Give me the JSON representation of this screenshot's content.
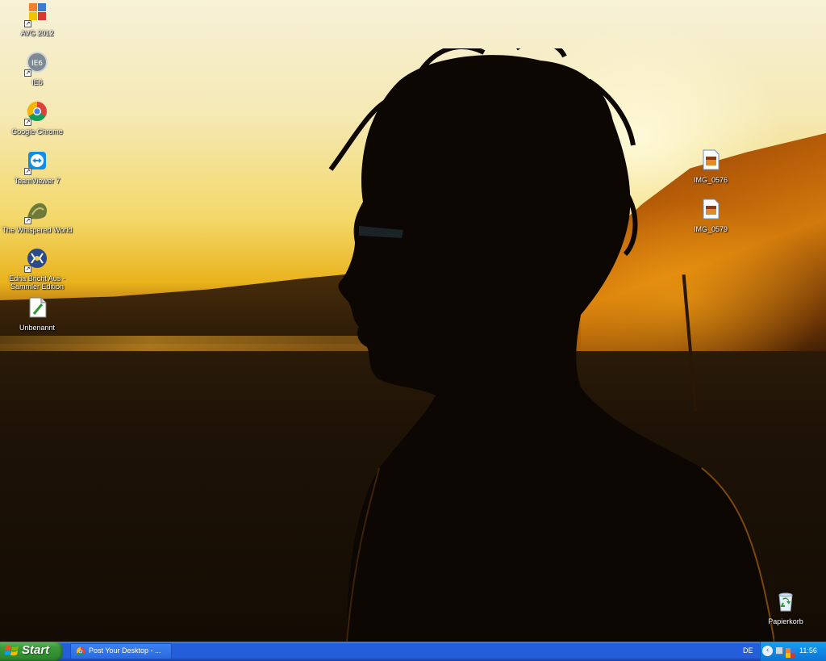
{
  "desktop": {
    "icons_left": [
      {
        "label": "AVG 2012",
        "icon": "avg-icon"
      },
      {
        "label": "IE6",
        "icon": "ie6-icon"
      },
      {
        "label": "Google Chrome",
        "icon": "chrome-icon"
      },
      {
        "label": "TeamViewer 7",
        "icon": "teamviewer-icon"
      },
      {
        "label": "The Whispered World",
        "icon": "whispered-world-icon"
      },
      {
        "label": "Edna Bricht Aus - Sammler Edition",
        "icon": "edna-icon"
      },
      {
        "label": "Unbenannt",
        "icon": "document-icon"
      }
    ],
    "icons_right": [
      {
        "label": "IMG_0576",
        "icon": "image-file-icon"
      },
      {
        "label": "IMG_0579",
        "icon": "image-file-icon"
      }
    ],
    "recycle_bin": {
      "label": "Papierkorb",
      "icon": "recycle-bin-icon"
    }
  },
  "taskbar": {
    "start_label": "Start",
    "task_label": "Post Your Desktop - ...",
    "language": "DE",
    "clock": "11:56"
  }
}
